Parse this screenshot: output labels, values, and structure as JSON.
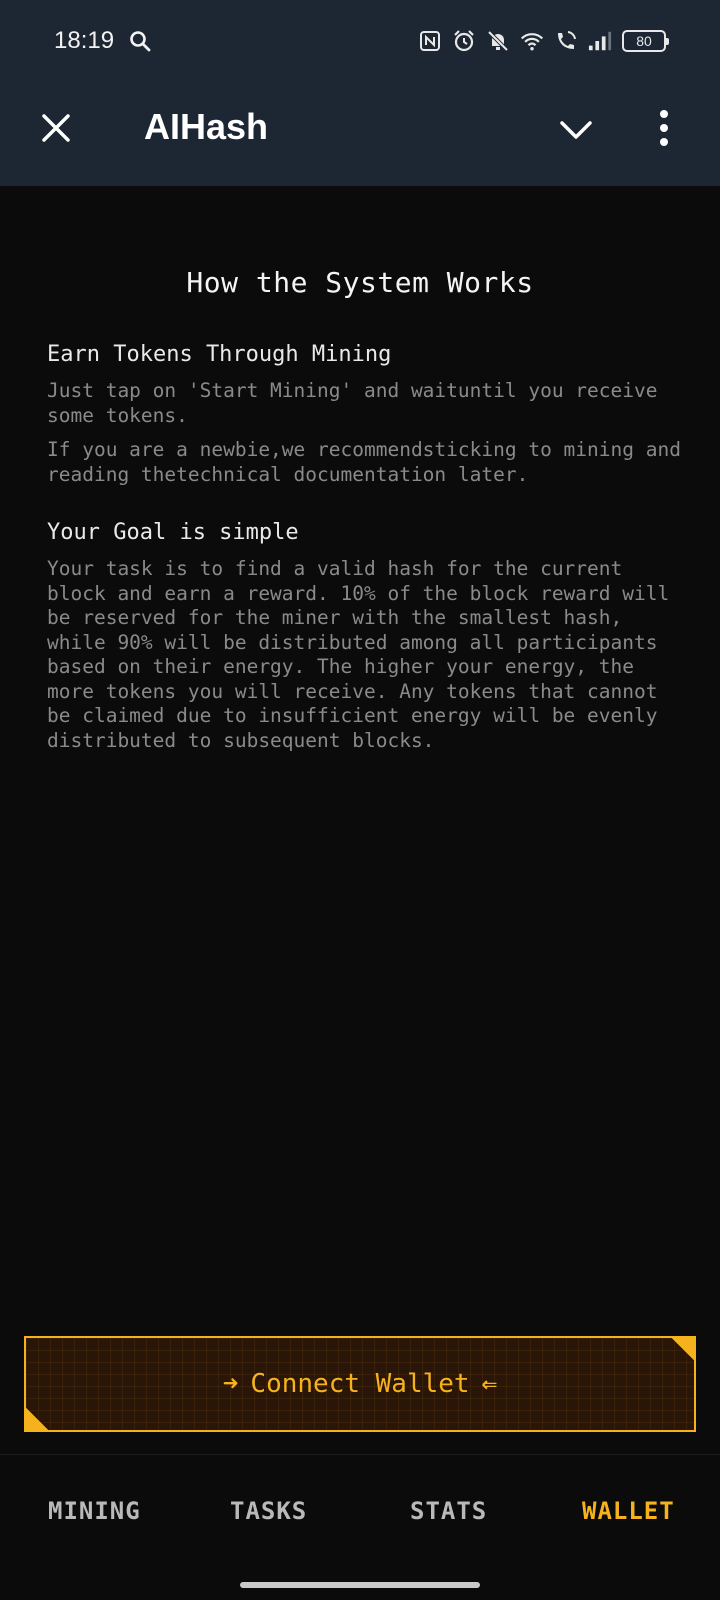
{
  "status_bar": {
    "time": "18:19",
    "battery": "80"
  },
  "app_bar": {
    "title": "AIHash"
  },
  "content": {
    "heading": "How the System Works",
    "sections": [
      {
        "title": "Earn Tokens Through Mining",
        "paragraphs": [
          "Just tap on 'Start Mining' and waituntil you receive some tokens.",
          "If you are a newbie,we recommendsticking to mining and reading thetechnical documentation later."
        ]
      },
      {
        "title": "Your Goal is simple",
        "paragraphs": [
          "Your task is to find a valid hash for the current block and earn a reward. 10% of the block reward will be reserved for the miner with the smallest hash, while 90% will be distributed among all participants based on their energy. The higher your energy, the more tokens you will receive. Any tokens that cannot be claimed due to insufficient energy will be evenly distributed to subsequent blocks."
        ]
      }
    ]
  },
  "connect_button": {
    "label": "Connect Wallet"
  },
  "tabs": [
    {
      "label": "MINING",
      "active": false
    },
    {
      "label": "TASKS",
      "active": false
    },
    {
      "label": "STATS",
      "active": false
    },
    {
      "label": "WALLET",
      "active": true
    }
  ],
  "colors": {
    "accent": "#f5b21c",
    "header_bg": "#1d2633",
    "page_bg": "#0b0b0c"
  }
}
